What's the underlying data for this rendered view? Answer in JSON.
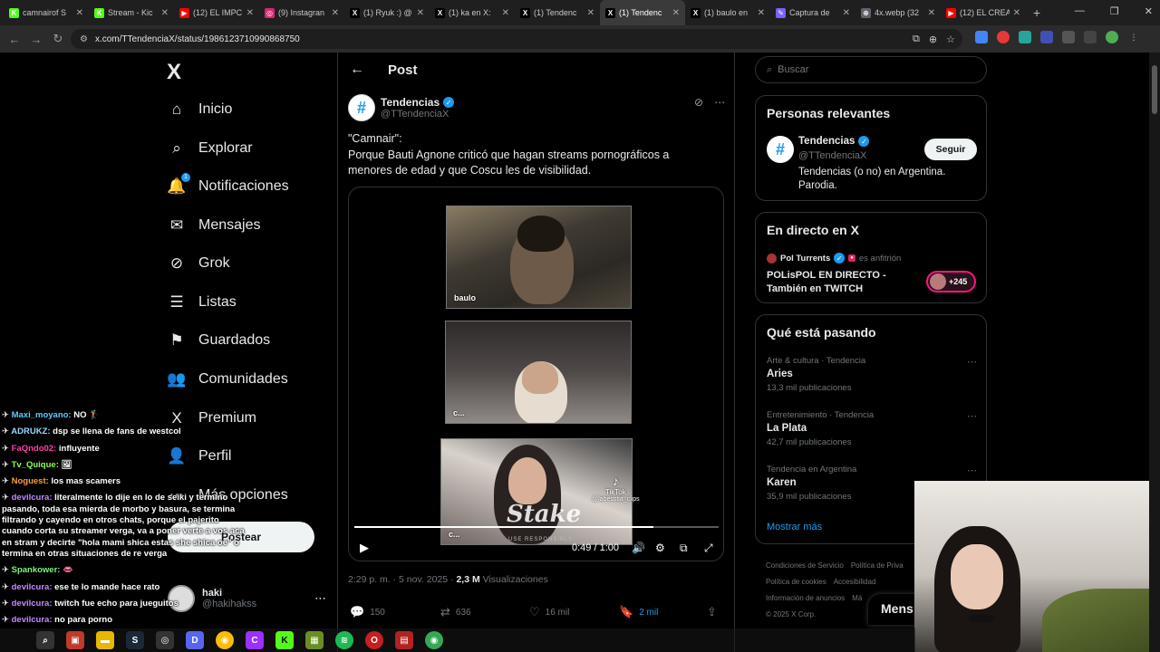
{
  "browser": {
    "tabs": [
      {
        "title": "camnairof S",
        "color": "#53fc18",
        "glyph": "K"
      },
      {
        "title": "Stream - Kic",
        "color": "#53fc18",
        "glyph": "K"
      },
      {
        "title": "(12) EL IMPC",
        "color": "#ff0000",
        "glyph": "▶"
      },
      {
        "title": "(9) Instagran",
        "color": "#d62976",
        "glyph": "◎"
      },
      {
        "title": "(1) Ryuk :) @",
        "color": "#000000",
        "glyph": "X"
      },
      {
        "title": "(1) ka en X:",
        "color": "#000000",
        "glyph": "X"
      },
      {
        "title": "(1) Tendenc",
        "color": "#000000",
        "glyph": "X"
      },
      {
        "title": "(1) Tendenc",
        "color": "#000000",
        "glyph": "X",
        "active": true
      },
      {
        "title": "(1) baulo en",
        "color": "#000000",
        "glyph": "X"
      },
      {
        "title": "Captura de",
        "color": "#7b61ff",
        "glyph": "✎"
      },
      {
        "title": "4x.webp (32",
        "color": "#5f6368",
        "glyph": "⊕"
      },
      {
        "title": "(12) EL CREA",
        "color": "#ff0000",
        "glyph": "▶"
      }
    ],
    "new_tab": "+",
    "url": "x.com/TTendenciaX/status/1986123710990868750"
  },
  "nav": {
    "logo": "X",
    "items": [
      {
        "label": "Inicio",
        "icon": "home-icon",
        "glyph": "⌂"
      },
      {
        "label": "Explorar",
        "icon": "search-icon",
        "glyph": "⌕"
      },
      {
        "label": "Notificaciones",
        "icon": "bell-icon",
        "glyph": "🔔",
        "badge": "1"
      },
      {
        "label": "Mensajes",
        "icon": "mail-icon",
        "glyph": "✉"
      },
      {
        "label": "Grok",
        "icon": "grok-icon",
        "glyph": "⊘"
      },
      {
        "label": "Listas",
        "icon": "list-icon",
        "glyph": "☰"
      },
      {
        "label": "Guardados",
        "icon": "bookmark-icon",
        "glyph": "⚑"
      },
      {
        "label": "Comunidades",
        "icon": "communities-icon",
        "glyph": "👥"
      },
      {
        "label": "Premium",
        "icon": "x-premium-icon",
        "glyph": "X"
      },
      {
        "label": "Perfil",
        "icon": "profile-icon",
        "glyph": "👤"
      },
      {
        "label": "Más opciones",
        "icon": "more-icon",
        "glyph": "⋯"
      }
    ],
    "post_button": "Postear",
    "account": {
      "name": "haki",
      "handle": "@hakihakss"
    }
  },
  "chat": [
    {
      "user": "Maxi_moyano:",
      "color": "#5ecbff",
      "text": "NO 🏌"
    },
    {
      "user": "ADRUKZ:",
      "color": "#9fd3ff",
      "text": "dsp se llena de fans de westcol"
    },
    {
      "user": "FaQndo02:",
      "color": "#ff3fa4",
      "text": "influyente"
    },
    {
      "user": "Tv_Quique:",
      "color": "#8cff5a",
      "text": "🖼"
    },
    {
      "user": "Noguest:",
      "color": "#ff9b3d",
      "text": "los mas scamers"
    },
    {
      "user": "devilcura:",
      "color": "#c08bff",
      "text": "literalmente lo dije en lo de seiki y termino pasando, toda esa mierda de morbo y basura, se termina filtrando y cayendo en otros chats, porque el pajerito cuando corta su streamer verga, va a poner verte a vos aca en stram y decirte \"hola mami shica estas she shica oe\" o termina en otras situaciones de re verga"
    },
    {
      "user": "Spankower:",
      "color": "#7cf57c",
      "text": "👄"
    },
    {
      "user": "devilcura:",
      "color": "#c08bff",
      "text": "ese te lo mande hace rato"
    },
    {
      "user": "devilcura:",
      "color": "#c08bff",
      "text": "twitch fue echo para jueguitos"
    },
    {
      "user": "devilcura:",
      "color": "#c08bff",
      "text": "no para porno"
    }
  ],
  "post": {
    "header_title": "Post",
    "author_name": "Tendencias",
    "author_handle": "@TTendenciaX",
    "avatar_glyph": "#",
    "text": "\"Camnair\":\nPorque Bauti Agnone criticó que hagan streams pornográficos a menores de edad y que Coscu les de visibilidad.",
    "video": {
      "frame_labels": [
        "baulo",
        "c...",
        "c..."
      ],
      "watermark": "Stake",
      "watermark_sub": "USE RESPONSIBLY",
      "tiktok_label": "TikTok",
      "tiktok_handle": "@labesstia_clips",
      "time": "0:49 / 1:00",
      "progress": 0.82
    },
    "meta_time": "2:29 p. m. · 5 nov. 2025 · ",
    "views_count": "2,3 M",
    "views_label": " Visualizaciones",
    "stats": {
      "replies": "150",
      "reposts": "636",
      "likes": "16 mil",
      "bookmarks": "2 mil"
    }
  },
  "right": {
    "search_placeholder": "Buscar",
    "relevant_title": "Personas relevantes",
    "relevant": {
      "name": "Tendencias",
      "handle": "@TTendenciaX",
      "bio": "Tendencias (o no) en Argentina. Parodia.",
      "follow": "Seguir"
    },
    "live_title": "En directo en X",
    "live": {
      "host": "Pol Turrents",
      "role": "es anfitrión",
      "title": "POLisPOL EN DIRECTO - También en TWITCH",
      "listeners": "+245"
    },
    "trends_title": "Qué está pasando",
    "trends": [
      {
        "context": "Arte & cultura · Tendencia",
        "name": "Aries",
        "count": "13,3 mil publicaciones"
      },
      {
        "context": "Entretenimiento · Tendencia",
        "name": "La Plata",
        "count": "42,7 mil publicaciones"
      },
      {
        "context": "Tendencia en Argentina",
        "name": "Karen",
        "count": "35,9 mil publicaciones"
      }
    ],
    "show_more": "Mostrar más",
    "footer": {
      "links": [
        "Condiciones de Servicio",
        "Política de Priva",
        "Política de cookies",
        "Accesibilidad",
        "Información de anuncios",
        "Má"
      ],
      "copyright": "© 2025 X Corp."
    },
    "messages_drawer": "Mens"
  },
  "colors": {
    "accent": "#1d9bf0",
    "live_ring": "#f91880"
  }
}
